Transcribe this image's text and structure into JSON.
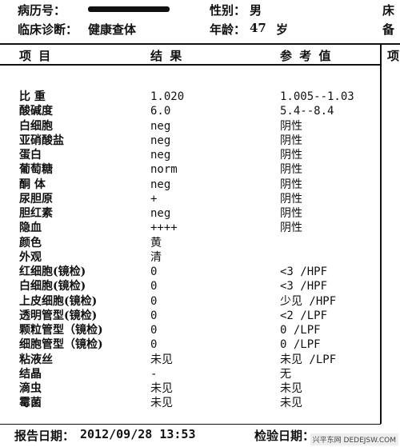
{
  "header": {
    "record_no_label": "病历号：",
    "gender_label": "性别：",
    "gender_value": "男",
    "right_clip_1": "床",
    "diagnosis_label": "临床诊断：",
    "diagnosis_value": "健康查体",
    "age_label": "年龄：",
    "age_value": "47",
    "age_unit": "岁",
    "right_clip_2": "备"
  },
  "table": {
    "columns": [
      "项    目",
      "结 果",
      "参 考 值"
    ],
    "right_clip_col": "项",
    "rows": [
      {
        "name": "比  重",
        "result": "1.020",
        "ref": "1.005--1.03"
      },
      {
        "name": "酸碱度",
        "result": "6.0",
        "ref": "5.4--8.4"
      },
      {
        "name": "白细胞",
        "result": "neg",
        "ref": "阴性"
      },
      {
        "name": "亚硝酸盐",
        "result": "neg",
        "ref": "阴性"
      },
      {
        "name": "蛋白",
        "result": "neg",
        "ref": "阴性"
      },
      {
        "name": "葡萄糖",
        "result": "norm",
        "ref": "阴性"
      },
      {
        "name": "酮  体",
        "result": "neg",
        "ref": "阴性"
      },
      {
        "name": "尿胆原",
        "result": "+",
        "ref": "阴性"
      },
      {
        "name": "胆红素",
        "result": "neg",
        "ref": "阴性"
      },
      {
        "name": "隐血",
        "result": "++++",
        "ref": "阴性"
      },
      {
        "name": "颜色",
        "result": "黄",
        "ref": ""
      },
      {
        "name": "外观",
        "result": "清",
        "ref": ""
      },
      {
        "name": "红细胞(镜检)",
        "result": "0",
        "ref": "<3 /HPF"
      },
      {
        "name": "白细胞(镜检)",
        "result": "0",
        "ref": "<3 /HPF"
      },
      {
        "name": "上皮细胞(镜检)",
        "result": "0",
        "ref": "少见 /HPF"
      },
      {
        "name": "透明管型(镜检)",
        "result": "0",
        "ref": "<2 /LPF"
      },
      {
        "name": "颗粒管型（镜检)",
        "result": "0",
        "ref": "0 /LPF"
      },
      {
        "name": "细胞管型（镜检)",
        "result": "0",
        "ref": "0 /LPF"
      },
      {
        "name": "粘液丝",
        "result": "未见",
        "ref": "未见 /LPF"
      },
      {
        "name": "结晶",
        "result": "-",
        "ref": "无"
      },
      {
        "name": "滴虫",
        "result": "未见",
        "ref": "未见"
      },
      {
        "name": "霉菌",
        "result": "未见",
        "ref": "未见"
      }
    ]
  },
  "footer": {
    "report_date_label": "报告日期：",
    "report_date_value": "2012/09/28 13:53",
    "inspect_date_label": "检验日期："
  },
  "watermark": "兴平东网 DEDEJSW.COM"
}
